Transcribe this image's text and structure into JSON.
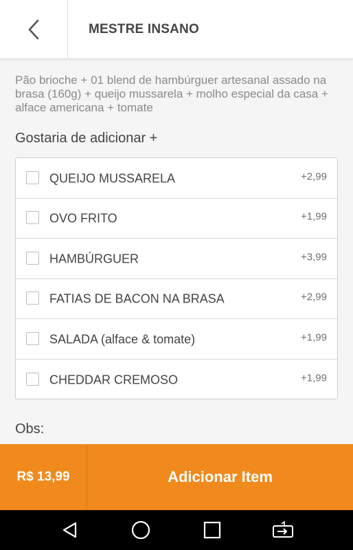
{
  "header": {
    "title": "MESTRE INSANO",
    "back_icon": "chevron-left-icon"
  },
  "product": {
    "description": "Pão brioche + 01 blend de hambúrguer artesanal assado na brasa (160g) + queijo mussarela + molho especial da casa + alface americana + tomate"
  },
  "addons": {
    "title": "Gostaria de adicionar +",
    "items": [
      {
        "label": "QUEIJO MUSSARELA",
        "price": "+2,99",
        "checked": false
      },
      {
        "label": "OVO FRITO",
        "price": "+1,99",
        "checked": false
      },
      {
        "label": "HAMBÚRGUER",
        "price": "+3,99",
        "checked": false
      },
      {
        "label": "FATIAS DE BACON NA BRASA",
        "price": "+2,99",
        "checked": false
      },
      {
        "label": "SALADA (alface & tomate)",
        "price": "+1,99",
        "checked": false
      },
      {
        "label": "CHEDDAR CREMOSO",
        "price": "+1,99",
        "checked": false
      }
    ]
  },
  "obs": {
    "label": "Obs:"
  },
  "footer": {
    "total": "R$ 13,99",
    "add_button": "Adicionar Item",
    "accent_color": "#f08a1d"
  },
  "system_nav": {
    "back_icon": "triangle-back-icon",
    "home_icon": "circle-home-icon",
    "recents_icon": "square-recents-icon",
    "rotate_icon": "screen-rotate-icon"
  }
}
